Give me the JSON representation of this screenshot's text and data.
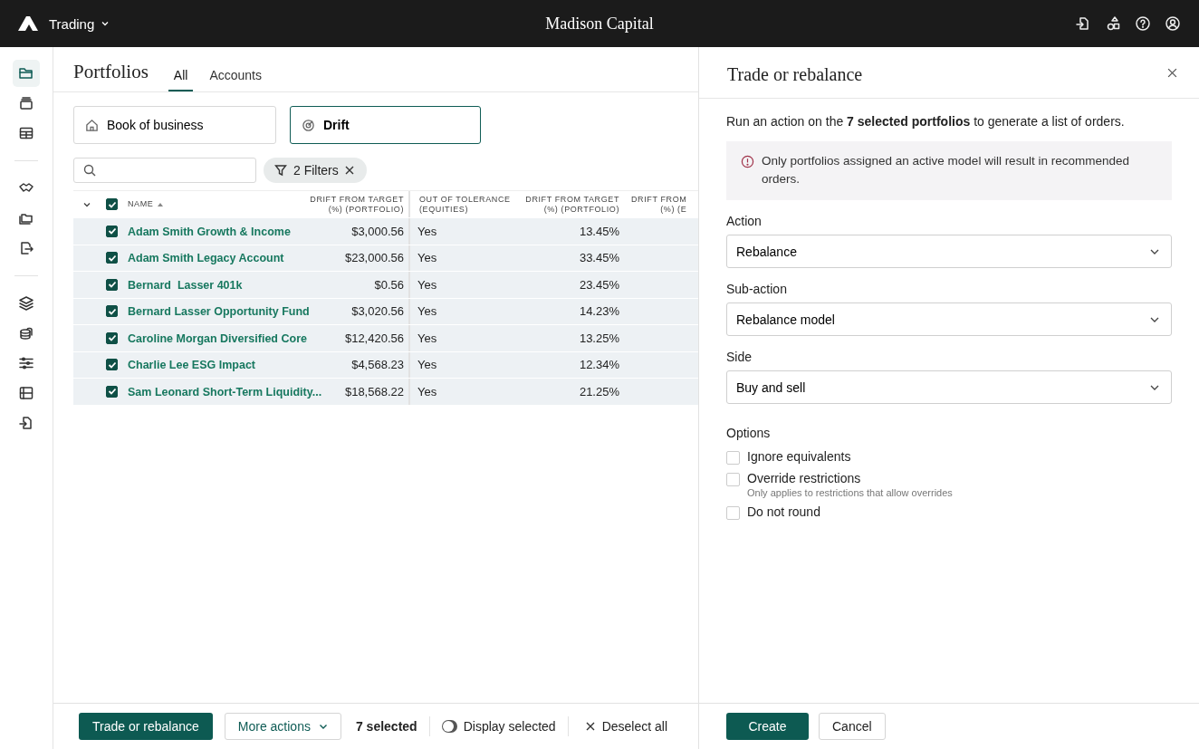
{
  "header": {
    "app": "Trading",
    "title": "Madison Capital"
  },
  "rail": {
    "groups": [
      [
        {
          "selected": true
        },
        {
          "selected": false
        },
        {
          "selected": false
        }
      ],
      [
        {
          "selected": false
        },
        {
          "selected": false
        },
        {
          "selected": false
        }
      ],
      [
        {
          "selected": false
        },
        {
          "selected": false
        },
        {
          "selected": false
        },
        {
          "selected": false
        },
        {
          "selected": false
        }
      ]
    ]
  },
  "main": {
    "title": "Portfolios",
    "tabs": [
      {
        "label": "All",
        "selected": true
      },
      {
        "label": "Accounts",
        "selected": false
      }
    ],
    "views": [
      {
        "label": "Book of business",
        "selected": false
      },
      {
        "label": "Drift",
        "selected": true
      }
    ],
    "filter_chip": "2 Filters",
    "table": {
      "all_checked": true,
      "columns": [
        {
          "label": "NAME",
          "sorted": true
        },
        {
          "label": "DRIFT FROM TARGET\n(%) (PORTFOLIO)",
          "sorted": false
        },
        {
          "label": "OUT OF TOLERANCE\n(EQUITIES)",
          "sorted": false
        },
        {
          "label": "DRIFT FROM TARGET\n(%) (PORTFOLIO)",
          "sorted": false
        },
        {
          "label": "DRIFT FROM\n(%) (E",
          "sorted": false
        }
      ],
      "rows": [
        {
          "checked": true,
          "name": "Adam Smith Growth & Income",
          "drift": "$3,000.56",
          "out_of_tolerance": "Yes",
          "drift_pct": "13.45%"
        },
        {
          "checked": true,
          "name": "Adam Smith Legacy Account",
          "drift": "$23,000.56",
          "out_of_tolerance": "Yes",
          "drift_pct": "33.45%"
        },
        {
          "checked": true,
          "name": "Bernard  Lasser 401k",
          "drift": "$0.56",
          "out_of_tolerance": "Yes",
          "drift_pct": "23.45%"
        },
        {
          "checked": true,
          "name": "Bernard Lasser Opportunity Fund",
          "drift": "$3,020.56",
          "out_of_tolerance": "Yes",
          "drift_pct": "14.23%"
        },
        {
          "checked": true,
          "name": "Caroline Morgan Diversified Core",
          "drift": "$12,420.56",
          "out_of_tolerance": "Yes",
          "drift_pct": "13.25%"
        },
        {
          "checked": true,
          "name": "Charlie Lee ESG Impact",
          "drift": "$4,568.23",
          "out_of_tolerance": "Yes",
          "drift_pct": "12.34%"
        },
        {
          "checked": true,
          "name": "Sam Leonard Short-Term Liquidity...",
          "drift": "$18,568.22",
          "out_of_tolerance": "Yes",
          "drift_pct": "21.25%"
        }
      ]
    },
    "action_bar": {
      "primary": "Trade or rebalance",
      "more": "More actions",
      "count": "7 selected",
      "toggle": {
        "label": "Display selected",
        "on": false
      },
      "deselect": "Deselect all"
    }
  },
  "panel": {
    "title": "Trade or rebalance",
    "intro": "Run an action on the **7 selected portfolios** to generate a list of orders.",
    "notice": "Only portfolios assigned an active model will result in recommended orders.",
    "fields": [
      {
        "label": "Action",
        "value": "Rebalance"
      },
      {
        "label": "Sub-action",
        "value": "Rebalance model"
      },
      {
        "label": "Side",
        "value": "Buy and sell"
      }
    ],
    "options_label": "Options",
    "options": [
      {
        "label": "Ignore equivalents",
        "checked": false
      },
      {
        "label": "Override restrictions",
        "checked": false,
        "hint": "Only applies to restrictions that allow overrides"
      },
      {
        "label": "Do not round",
        "checked": false
      }
    ],
    "buttons": [
      {
        "label": "Create",
        "kind": "primary"
      },
      {
        "label": "Cancel",
        "kind": "secondary"
      }
    ]
  }
}
